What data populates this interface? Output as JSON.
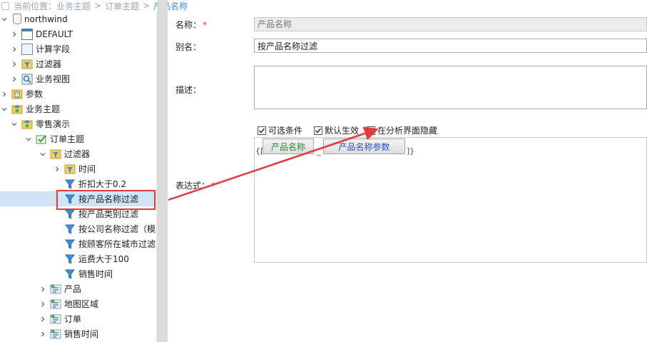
{
  "breadcrumb": {
    "prefix": "当前位置：",
    "items": [
      "业务主题",
      "订单主题",
      "产品名称"
    ],
    "separator": ">"
  },
  "tree": {
    "items": [
      {
        "label": "northwind",
        "icon": "database-icon"
      },
      {
        "label": "DEFAULT",
        "icon": "table-icon"
      },
      {
        "label": "计算字段",
        "icon": "calculated-field-icon"
      },
      {
        "label": "过滤器",
        "icon": "filter-icon"
      },
      {
        "label": "业务视图",
        "icon": "view-icon"
      },
      {
        "label": "参数",
        "icon": "parameter-icon"
      },
      {
        "label": "业务主题",
        "icon": "topic-folder-icon"
      },
      {
        "label": "零售演示",
        "icon": "topic-folder-icon"
      },
      {
        "label": "订单主题",
        "icon": "check-topic-icon"
      },
      {
        "label": "过滤器",
        "icon": "filter-folder-icon"
      },
      {
        "label": "时间",
        "icon": "filter-folder-icon"
      },
      {
        "label": "折扣大于0.2",
        "icon": "filter-icon"
      },
      {
        "label": "按产品名称过滤",
        "icon": "filter-icon"
      },
      {
        "label": "按产品类别过滤",
        "icon": "filter-icon"
      },
      {
        "label": "按公司名称过滤（模",
        "icon": "filter-icon"
      },
      {
        "label": "按顾客所在城市过滤",
        "icon": "filter-icon"
      },
      {
        "label": "运费大于100",
        "icon": "filter-icon"
      },
      {
        "label": "销售时间",
        "icon": "filter-icon"
      },
      {
        "label": "产品",
        "icon": "dimension-icon"
      },
      {
        "label": "地图区域",
        "icon": "dimension-icon"
      },
      {
        "label": "订单",
        "icon": "dimension-icon"
      },
      {
        "label": "销售时间",
        "icon": "dimension-icon"
      }
    ]
  },
  "form": {
    "name_label": "名称：",
    "required_mark": "*",
    "name_placeholder": "产品名称",
    "alias_label": "别名：",
    "alias_value": "按产品名称过滤",
    "desc_label": "描述：",
    "optional_label": "可选条件",
    "default_label": "默认生效",
    "hide_label": "在分析界面隐藏",
    "expr_label": "表达式：",
    "expr_open": "{[",
    "expr_field": "产品名称",
    "expr_sep": "_",
    "expr_param": "产品名称参数",
    "expr_close": "]}"
  },
  "colors": {
    "highlight_red": "#e23b3b",
    "selected_bg": "#cfe4f7",
    "breadcrumb_current": "#3a8ee6"
  }
}
